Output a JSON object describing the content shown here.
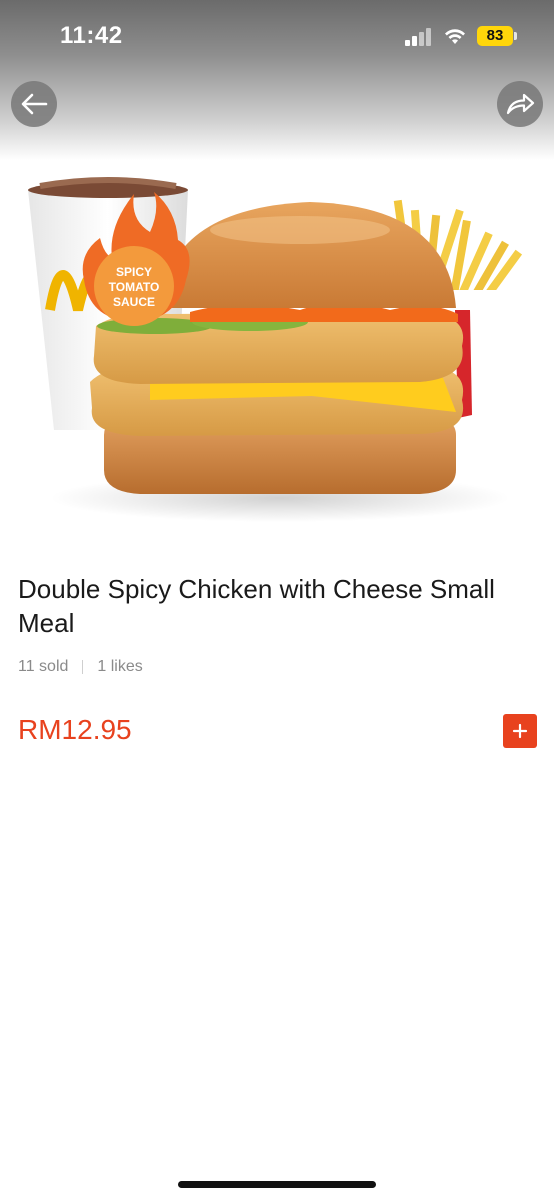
{
  "status": {
    "time": "11:42",
    "battery": "83"
  },
  "badge": {
    "line1": "SPICY",
    "line2": "TOMATO",
    "line3": "SAUCE"
  },
  "product": {
    "name": "Double Spicy Chicken with Cheese Small Meal",
    "sold": "11 sold",
    "likes": "1 likes",
    "price": "RM12.95"
  },
  "icons": {
    "back": "arrow-left-icon",
    "share": "share-arrow-icon",
    "add": "plus-icon"
  },
  "colors": {
    "accent": "#e8421e",
    "battery": "#ffd60a"
  }
}
